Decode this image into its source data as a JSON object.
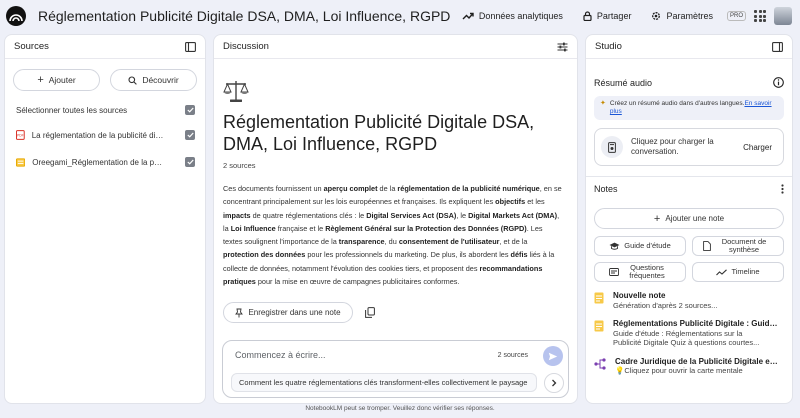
{
  "header": {
    "title": "Réglementation Publicité Digitale DSA, DMA, Loi Influence, RGPD",
    "analytics_label": "Données analytiques",
    "share_label": "Partager",
    "settings_label": "Paramètres",
    "pro_badge": "PRO"
  },
  "sources": {
    "title": "Sources",
    "add_label": "Ajouter",
    "discover_label": "Découvrir",
    "select_all_label": "Sélectionner toutes les sources",
    "items": [
      {
        "name": "La réglementation de la publicité digit...",
        "type": "PDF"
      },
      {
        "name": "Oreegami_Réglementation de la public..."
      }
    ]
  },
  "discussion": {
    "title": "Discussion",
    "doc_title": "Réglementation Publicité Digitale DSA, DMA, Loi Influence, RGPD",
    "source_count": "2 sources",
    "summary": [
      {
        "t": "Ces documents fournissent un "
      },
      {
        "t": "aperçu complet",
        "b": true
      },
      {
        "t": " de la "
      },
      {
        "t": "réglementation de la publicité numérique",
        "b": true
      },
      {
        "t": ", en se concentrant principalement sur les lois européennes et françaises. Ils expliquent les "
      },
      {
        "t": "objectifs",
        "b": true
      },
      {
        "t": " et les "
      },
      {
        "t": "impacts",
        "b": true
      },
      {
        "t": " de quatre réglementations clés : le "
      },
      {
        "t": "Digital Services Act (DSA)",
        "b": true
      },
      {
        "t": ", le "
      },
      {
        "t": "Digital Markets Act (DMA)",
        "b": true
      },
      {
        "t": ", la "
      },
      {
        "t": "Loi Influence",
        "b": true
      },
      {
        "t": " française et le "
      },
      {
        "t": "Règlement Général sur la Protection des Données (RGPD)",
        "b": true
      },
      {
        "t": ". Les textes soulignent l'importance de la "
      },
      {
        "t": "transparence",
        "b": true
      },
      {
        "t": ", du "
      },
      {
        "t": "consentement de l'utilisateur",
        "b": true
      },
      {
        "t": ", et de la "
      },
      {
        "t": "protection des données",
        "b": true
      },
      {
        "t": " pour les professionnels du marketing. De plus, ils abordent les "
      },
      {
        "t": "défis",
        "b": true
      },
      {
        "t": " liés à la collecte de données, notamment l'évolution des cookies tiers, et proposent des "
      },
      {
        "t": "recommandations pratiques",
        "b": true
      },
      {
        "t": " pour la mise en œuvre de campagnes publicitaires conformes."
      }
    ],
    "save_note_label": "Enregistrer dans une note",
    "chat_placeholder": "Commencez à écrire...",
    "chat_source_count": "2 sources",
    "suggestion": "Comment les quatre réglementations clés transforment-elles collectivement le paysage"
  },
  "studio": {
    "title": "Studio",
    "audio_title": "Résumé audio",
    "info_text": "Créez un résumé audio dans d'autres langues.",
    "info_link": "En savoir plus",
    "load_text": "Cliquez pour charger la conversation.",
    "load_button": "Charger",
    "notes_title": "Notes",
    "add_note_label": "Ajouter une note",
    "tools": [
      {
        "label": "Guide d'étude",
        "icon": "graduation-cap-icon"
      },
      {
        "label": "Document de synthèse",
        "icon": "document-icon"
      },
      {
        "label": "Questions fréquentes",
        "icon": "faq-icon"
      },
      {
        "label": "Timeline",
        "icon": "timeline-icon"
      }
    ],
    "notes": [
      {
        "title": "Nouvelle note",
        "sub": "Génération d'après 2 sources...",
        "icon": "note-icon"
      },
      {
        "title": "Réglementations Publicité Digitale : Guide ...",
        "sub": "Guide d'étude : Réglementations sur la",
        "sub2": "Publicité Digitale Quiz à questions courtes...",
        "icon": "note-icon"
      },
      {
        "title": "Cadre Juridique de la Publicité Digitale en...",
        "sub": "Cliquez pour ouvrir la carte mentale",
        "icon": "mind-map-icon"
      }
    ]
  },
  "footer": "NotebookLM peut se tromper. Veuillez donc vérifier ses réponses.",
  "colors": {
    "accent": "#1a56d6",
    "send": "#b7c3ee",
    "background": "#eef0f8"
  }
}
